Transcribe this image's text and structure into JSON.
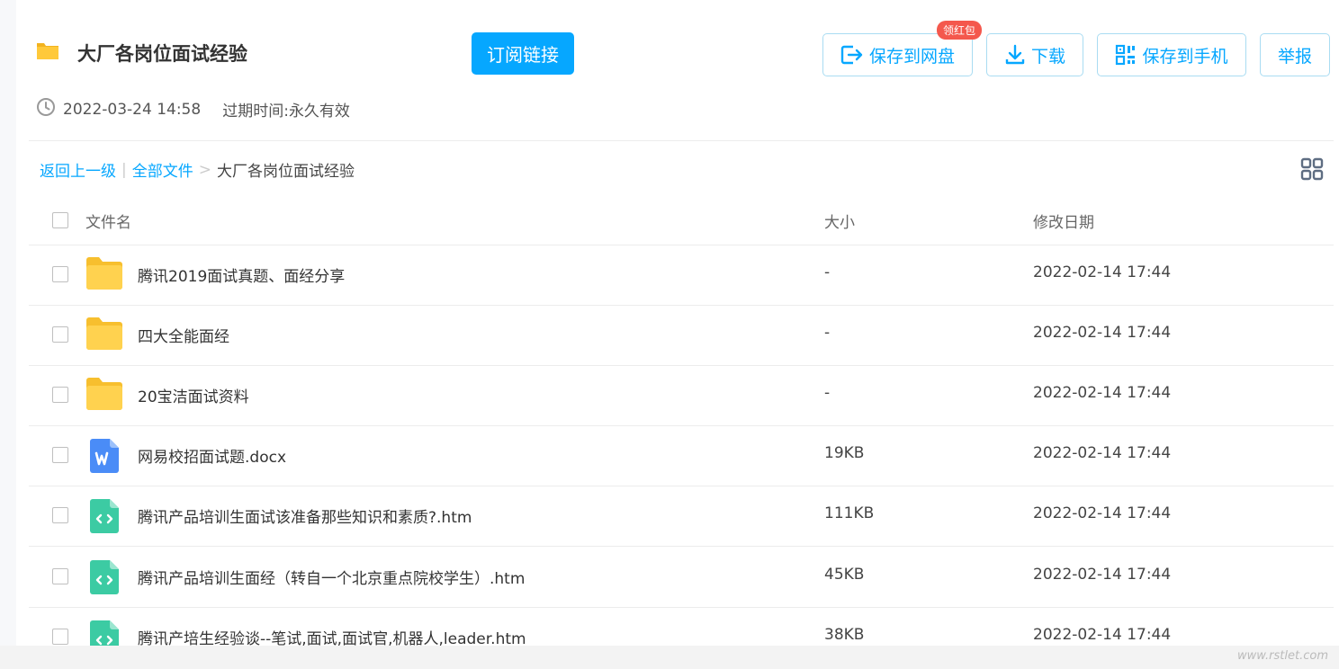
{
  "share": {
    "title": "大厂各岗位面试经验",
    "subscribe_label": "订阅链接",
    "created_time": "2022-03-24 14:58",
    "expire_label": "过期时间:",
    "expire_value": "永久有效"
  },
  "actions": {
    "save_disk": "保存到网盘",
    "badge": "领红包",
    "download": "下载",
    "save_phone": "保存到手机",
    "report": "举报"
  },
  "breadcrumb": {
    "back": "返回上一级",
    "divider": "|",
    "all_files": "全部文件",
    "arrow": ">",
    "current": "大厂各岗位面试经验"
  },
  "table": {
    "columns": {
      "name": "文件名",
      "size": "大小",
      "date": "修改日期"
    },
    "rows": [
      {
        "name": "腾讯2019面试真题、面经分享",
        "size": "-",
        "date": "2022-02-14 17:44",
        "type": "folder-icon"
      },
      {
        "name": "四大全能面经",
        "size": "-",
        "date": "2022-02-14 17:44",
        "type": "folder-icon"
      },
      {
        "name": "20宝洁面试资料",
        "size": "-",
        "date": "2022-02-14 17:44",
        "type": "folder-icon"
      },
      {
        "name": "网易校招面试题.docx",
        "size": "19KB",
        "date": "2022-02-14 17:44",
        "type": "word-doc-icon"
      },
      {
        "name": "腾讯产品培训生面试该准备那些知识和素质?.htm",
        "size": "111KB",
        "date": "2022-02-14 17:44",
        "type": "html-file-icon"
      },
      {
        "name": "腾讯产品培训生面经（转自一个北京重点院校学生）.htm",
        "size": "45KB",
        "date": "2022-02-14 17:44",
        "type": "html-file-icon"
      },
      {
        "name": "腾讯产培生经验谈--笔试,面试,面试官,机器人,leader.htm",
        "size": "38KB",
        "date": "2022-02-14 17:44",
        "type": "html-file-icon"
      }
    ]
  },
  "colors": {
    "accent": "#06a7ff",
    "badge": "#f4584d",
    "folder": "#ffd24f",
    "word": "#4a8cf7",
    "html": "#3ccba3"
  },
  "watermark": "www.rstlet.com"
}
